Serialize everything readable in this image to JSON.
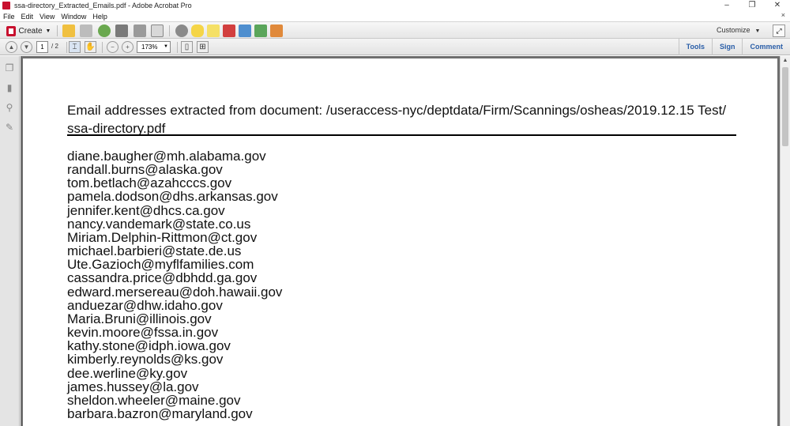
{
  "window": {
    "title": "ssa-directory_Extracted_Emails.pdf - Adobe Acrobat Pro",
    "controls": {
      "minimize": "–",
      "restore": "❐",
      "close": "✕"
    }
  },
  "menu": {
    "items": [
      "File",
      "Edit",
      "View",
      "Window",
      "Help"
    ],
    "close_doc": "×"
  },
  "toolbar": {
    "create_label": "Create",
    "customize_label": "Customize",
    "icons": [
      "open-icon",
      "save-icon",
      "upload-icon",
      "print-icon",
      "edit-icon",
      "email-icon",
      "settings-icon",
      "comment-icon",
      "highlight-icon",
      "pdf-convert-icon",
      "combine-icon",
      "export-icon",
      "protect-icon"
    ]
  },
  "nav": {
    "current_page": "1",
    "total_pages": "/ 2",
    "zoom": "173%",
    "links": {
      "tools": "Tools",
      "sign": "Sign",
      "comment": "Comment"
    }
  },
  "document": {
    "heading": "Email addresses extracted from document: /useraccess-nyc/deptdata/Firm/Scannings/osheas/2019.12.15 Test/ ssa-directory.pdf",
    "emails": [
      "diane.baugher@mh.alabama.gov",
      "randall.burns@alaska.gov",
      "tom.betlach@azahcccs.gov",
      "pamela.dodson@dhs.arkansas.gov",
      "jennifer.kent@dhcs.ca.gov",
      "nancy.vandemark@state.co.us",
      "Miriam.Delphin-Rittmon@ct.gov",
      "michael.barbieri@state.de.us",
      "Ute.Gazioch@myflfamilies.com",
      "cassandra.price@dbhdd.ga.gov",
      "edward.mersereau@doh.hawaii.gov",
      "anduezar@dhw.idaho.gov",
      "Maria.Bruni@illinois.gov",
      "kevin.moore@fssa.in.gov",
      "kathy.stone@idph.iowa.gov",
      "kimberly.reynolds@ks.gov",
      "dee.werline@ky.gov",
      "james.hussey@la.gov",
      "sheldon.wheeler@maine.gov",
      "barbara.bazron@maryland.gov"
    ]
  }
}
